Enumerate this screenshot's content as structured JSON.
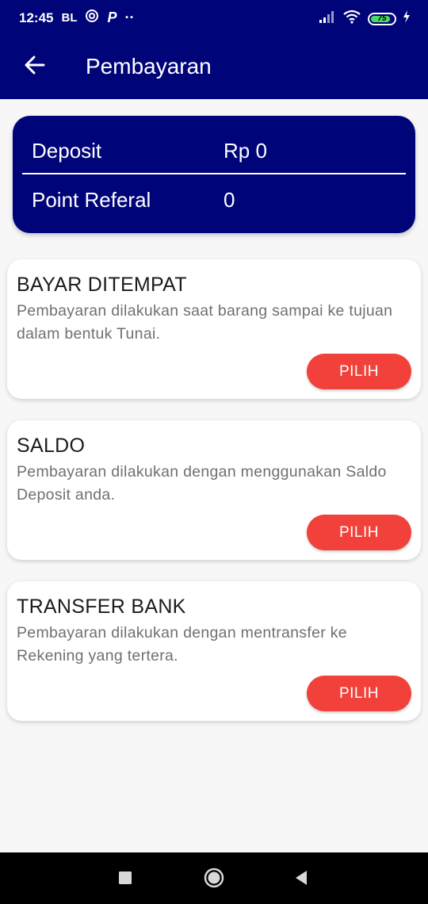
{
  "status_bar": {
    "time": "12:45",
    "carrier_badge": "BL",
    "parking_badge": "P",
    "dots": "··",
    "battery_level": "75",
    "icons": [
      "vpn-icon",
      "signal-icon",
      "wifi-icon",
      "battery-icon",
      "charging-icon"
    ]
  },
  "app_bar": {
    "title": "Pembayaran",
    "back_icon": "arrow-left-icon"
  },
  "wallet": {
    "deposit_label": "Deposit",
    "deposit_value": "Rp 0",
    "referral_label": "Point Referal",
    "referral_value": "0"
  },
  "payment_options": [
    {
      "title": "BAYAR DITEMPAT",
      "description": "Pembayaran dilakukan saat barang sampai ke tujuan dalam bentuk Tunai.",
      "button_label": "PILIH"
    },
    {
      "title": "SALDO",
      "description": "Pembayaran dilakukan dengan menggunakan Saldo Deposit anda.",
      "button_label": "PILIH"
    },
    {
      "title": "TRANSFER BANK",
      "description": "Pembayaran dilakukan dengan mentransfer ke Rekening yang tertera.",
      "button_label": "PILIH"
    }
  ],
  "nav_bar": {
    "icons": [
      "recent-apps-icon",
      "home-icon",
      "back-triangle-icon"
    ]
  },
  "colors": {
    "primary": "#000479",
    "accent": "#f2413a",
    "background": "#f7f7f7"
  }
}
